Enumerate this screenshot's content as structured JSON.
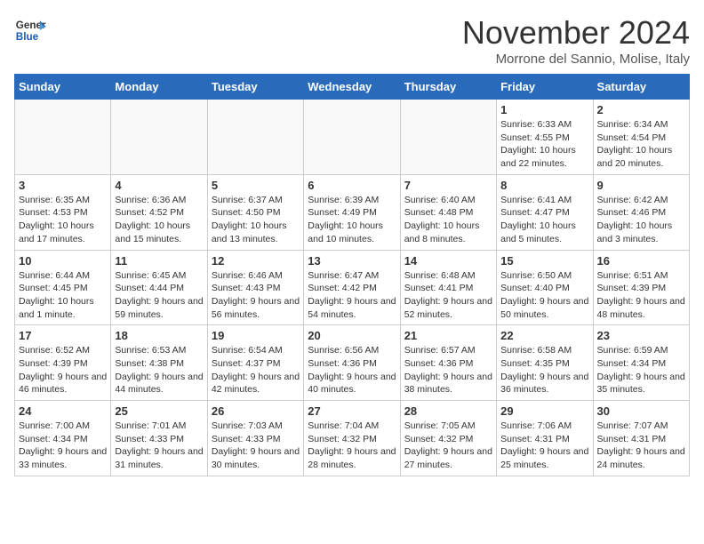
{
  "header": {
    "logo_line1": "General",
    "logo_line2": "Blue",
    "month_title": "November 2024",
    "location": "Morrone del Sannio, Molise, Italy"
  },
  "days_of_week": [
    "Sunday",
    "Monday",
    "Tuesday",
    "Wednesday",
    "Thursday",
    "Friday",
    "Saturday"
  ],
  "weeks": [
    [
      {
        "day": "",
        "info": ""
      },
      {
        "day": "",
        "info": ""
      },
      {
        "day": "",
        "info": ""
      },
      {
        "day": "",
        "info": ""
      },
      {
        "day": "",
        "info": ""
      },
      {
        "day": "1",
        "info": "Sunrise: 6:33 AM\nSunset: 4:55 PM\nDaylight: 10 hours and 22 minutes."
      },
      {
        "day": "2",
        "info": "Sunrise: 6:34 AM\nSunset: 4:54 PM\nDaylight: 10 hours and 20 minutes."
      }
    ],
    [
      {
        "day": "3",
        "info": "Sunrise: 6:35 AM\nSunset: 4:53 PM\nDaylight: 10 hours and 17 minutes."
      },
      {
        "day": "4",
        "info": "Sunrise: 6:36 AM\nSunset: 4:52 PM\nDaylight: 10 hours and 15 minutes."
      },
      {
        "day": "5",
        "info": "Sunrise: 6:37 AM\nSunset: 4:50 PM\nDaylight: 10 hours and 13 minutes."
      },
      {
        "day": "6",
        "info": "Sunrise: 6:39 AM\nSunset: 4:49 PM\nDaylight: 10 hours and 10 minutes."
      },
      {
        "day": "7",
        "info": "Sunrise: 6:40 AM\nSunset: 4:48 PM\nDaylight: 10 hours and 8 minutes."
      },
      {
        "day": "8",
        "info": "Sunrise: 6:41 AM\nSunset: 4:47 PM\nDaylight: 10 hours and 5 minutes."
      },
      {
        "day": "9",
        "info": "Sunrise: 6:42 AM\nSunset: 4:46 PM\nDaylight: 10 hours and 3 minutes."
      }
    ],
    [
      {
        "day": "10",
        "info": "Sunrise: 6:44 AM\nSunset: 4:45 PM\nDaylight: 10 hours and 1 minute."
      },
      {
        "day": "11",
        "info": "Sunrise: 6:45 AM\nSunset: 4:44 PM\nDaylight: 9 hours and 59 minutes."
      },
      {
        "day": "12",
        "info": "Sunrise: 6:46 AM\nSunset: 4:43 PM\nDaylight: 9 hours and 56 minutes."
      },
      {
        "day": "13",
        "info": "Sunrise: 6:47 AM\nSunset: 4:42 PM\nDaylight: 9 hours and 54 minutes."
      },
      {
        "day": "14",
        "info": "Sunrise: 6:48 AM\nSunset: 4:41 PM\nDaylight: 9 hours and 52 minutes."
      },
      {
        "day": "15",
        "info": "Sunrise: 6:50 AM\nSunset: 4:40 PM\nDaylight: 9 hours and 50 minutes."
      },
      {
        "day": "16",
        "info": "Sunrise: 6:51 AM\nSunset: 4:39 PM\nDaylight: 9 hours and 48 minutes."
      }
    ],
    [
      {
        "day": "17",
        "info": "Sunrise: 6:52 AM\nSunset: 4:39 PM\nDaylight: 9 hours and 46 minutes."
      },
      {
        "day": "18",
        "info": "Sunrise: 6:53 AM\nSunset: 4:38 PM\nDaylight: 9 hours and 44 minutes."
      },
      {
        "day": "19",
        "info": "Sunrise: 6:54 AM\nSunset: 4:37 PM\nDaylight: 9 hours and 42 minutes."
      },
      {
        "day": "20",
        "info": "Sunrise: 6:56 AM\nSunset: 4:36 PM\nDaylight: 9 hours and 40 minutes."
      },
      {
        "day": "21",
        "info": "Sunrise: 6:57 AM\nSunset: 4:36 PM\nDaylight: 9 hours and 38 minutes."
      },
      {
        "day": "22",
        "info": "Sunrise: 6:58 AM\nSunset: 4:35 PM\nDaylight: 9 hours and 36 minutes."
      },
      {
        "day": "23",
        "info": "Sunrise: 6:59 AM\nSunset: 4:34 PM\nDaylight: 9 hours and 35 minutes."
      }
    ],
    [
      {
        "day": "24",
        "info": "Sunrise: 7:00 AM\nSunset: 4:34 PM\nDaylight: 9 hours and 33 minutes."
      },
      {
        "day": "25",
        "info": "Sunrise: 7:01 AM\nSunset: 4:33 PM\nDaylight: 9 hours and 31 minutes."
      },
      {
        "day": "26",
        "info": "Sunrise: 7:03 AM\nSunset: 4:33 PM\nDaylight: 9 hours and 30 minutes."
      },
      {
        "day": "27",
        "info": "Sunrise: 7:04 AM\nSunset: 4:32 PM\nDaylight: 9 hours and 28 minutes."
      },
      {
        "day": "28",
        "info": "Sunrise: 7:05 AM\nSunset: 4:32 PM\nDaylight: 9 hours and 27 minutes."
      },
      {
        "day": "29",
        "info": "Sunrise: 7:06 AM\nSunset: 4:31 PM\nDaylight: 9 hours and 25 minutes."
      },
      {
        "day": "30",
        "info": "Sunrise: 7:07 AM\nSunset: 4:31 PM\nDaylight: 9 hours and 24 minutes."
      }
    ]
  ]
}
